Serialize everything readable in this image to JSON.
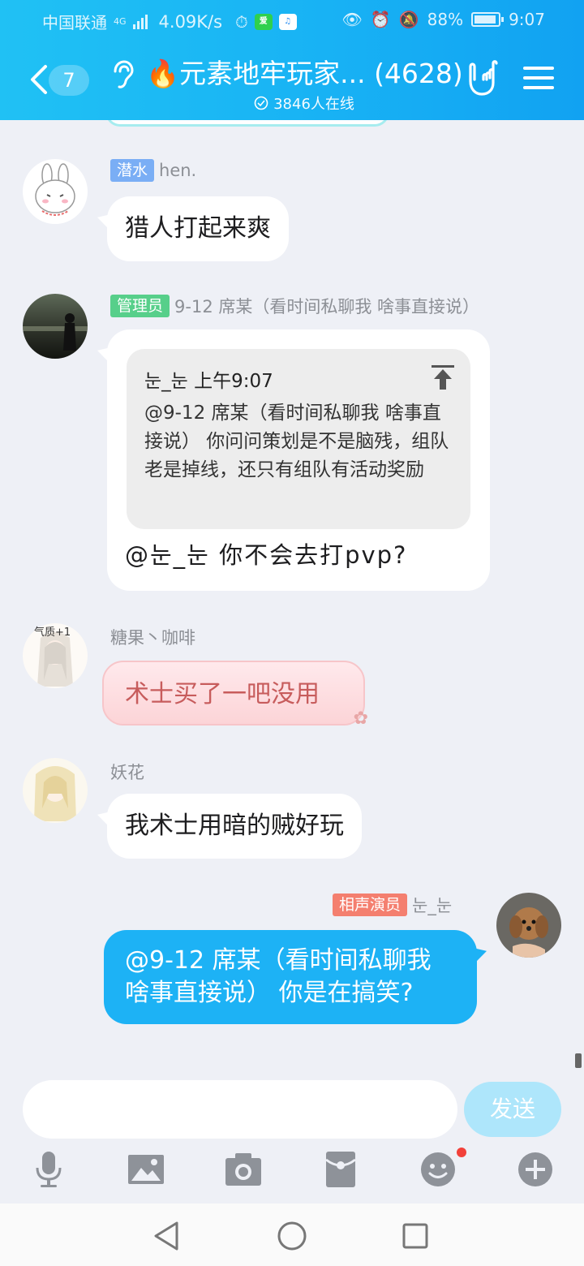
{
  "status_bar": {
    "carrier": "中国联通",
    "network": "4G",
    "speed": "4.09K/s",
    "app_chip": "爱",
    "battery": "88%",
    "time": "9:07"
  },
  "header": {
    "unread_count": "7",
    "title": "🔥元素地牢玩家...",
    "member_count": "(4628)",
    "online": "3846人在线"
  },
  "messages": [
    {
      "tag": "潜水",
      "tag_color": "#7aaef5",
      "sender": "hen.",
      "text": "猎人打起来爽"
    },
    {
      "tag": "管理员",
      "tag_color": "#57cf8a",
      "sender": "9-12 席某（看时间私聊我 啥事直接说）",
      "quote": {
        "header": "눈_눈  上午9:07",
        "body": "@9-12 席某（看时间私聊我 啥事直接说） 你问问策划是不是脑残，组队老是掉线，还只有组队有活动奖励"
      },
      "text": "@눈_눈  你不会去打pvp?"
    },
    {
      "avatar_label": "气质+1",
      "sender": "糖果丶咖啡",
      "text": "术士买了一吧没用"
    },
    {
      "sender": "妖花",
      "text": "我术士用暗的贼好玩"
    },
    {
      "tag": "相声演员",
      "tag_color": "#f47f6f",
      "sender": "눈_눈",
      "text": "@9-12 席某（看时间私聊我 啥事直接说） 你是在搞笑?"
    }
  ],
  "input": {
    "placeholder": "",
    "send_label": "发送"
  },
  "colors": {
    "header": "#19b4f4",
    "my_bubble": "#1db2f5",
    "background": "#eef0f6"
  }
}
